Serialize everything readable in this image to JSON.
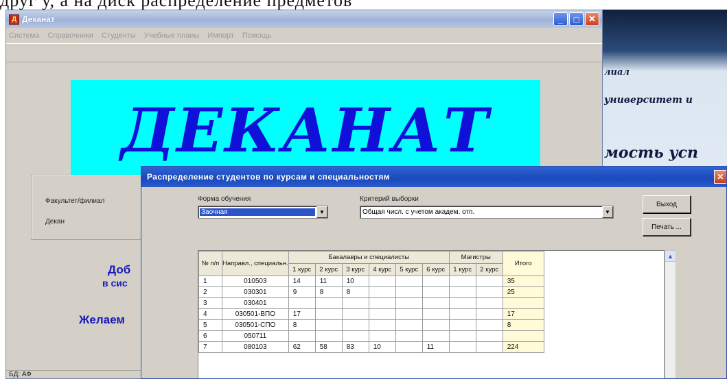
{
  "doc_text_top": "друг у, а на диск распределение предметов",
  "background_doc": {
    "lines": [
      "лиал",
      "университет и",
      "мость усп"
    ]
  },
  "main_window": {
    "title": "Деканат",
    "app_icon_letter": "Д",
    "menu": [
      "Система",
      "Справочники",
      "Студенты",
      "Учебные планы",
      "Импорт",
      "Помощь"
    ],
    "banner_text": "ДЕКАНАТ",
    "faculty_label": "Факультет/филиал",
    "dean_label": "Декан",
    "welcome_line1": "Доб",
    "welcome_line2": "в сис",
    "welcome_line3": "Желаем",
    "status_db": "БД: АФ",
    "buttons": {
      "minimize": "_",
      "maximize": "□",
      "close": "✕"
    }
  },
  "dialog": {
    "title": "Распределение студентов по курсам и специальностям",
    "close_glyph": "✕",
    "form_label": "Форма обучения",
    "form_value": "Заочная",
    "criterion_label": "Критерий выборки",
    "criterion_value": "Общая числ. с учетом академ. отп.",
    "exit_button": "Выход",
    "print_button": "Печать ...",
    "table": {
      "header_num": "№ п/п",
      "header_spec": "Направл., специальн.",
      "header_bach_group": "Бакалавры и специалисты",
      "header_mag_group": "Магистры",
      "header_total": "Итого",
      "bach_courses": [
        "1 курс",
        "2 курс",
        "3 курс",
        "4 курс",
        "5 курс",
        "6 курс"
      ],
      "mag_courses": [
        "1 курс",
        "2 курс"
      ],
      "rows": [
        {
          "n": "1",
          "spec": "010503",
          "b": [
            "14",
            "11",
            "10",
            "",
            "",
            ""
          ],
          "m": [
            "",
            ""
          ],
          "total": "35"
        },
        {
          "n": "2",
          "spec": "030301",
          "b": [
            "9",
            "8",
            "8",
            "",
            "",
            ""
          ],
          "m": [
            "",
            ""
          ],
          "total": "25"
        },
        {
          "n": "3",
          "spec": "030401",
          "b": [
            "",
            "",
            "",
            "",
            "",
            ""
          ],
          "m": [
            "",
            ""
          ],
          "total": ""
        },
        {
          "n": "4",
          "spec": "030501-ВПО",
          "b": [
            "17",
            "",
            "",
            "",
            "",
            ""
          ],
          "m": [
            "",
            ""
          ],
          "total": "17"
        },
        {
          "n": "5",
          "spec": "030501-СПО",
          "b": [
            "8",
            "",
            "",
            "",
            "",
            ""
          ],
          "m": [
            "",
            ""
          ],
          "total": "8"
        },
        {
          "n": "6",
          "spec": "050711",
          "b": [
            "",
            "",
            "",
            "",
            "",
            ""
          ],
          "m": [
            "",
            ""
          ],
          "total": ""
        },
        {
          "n": "7",
          "spec": "080103",
          "b": [
            "62",
            "58",
            "83",
            "10",
            "",
            "11"
          ],
          "m": [
            "",
            ""
          ],
          "total": "224"
        }
      ]
    },
    "scroll_up_glyph": "▲",
    "dropdown_glyph": "▼"
  }
}
